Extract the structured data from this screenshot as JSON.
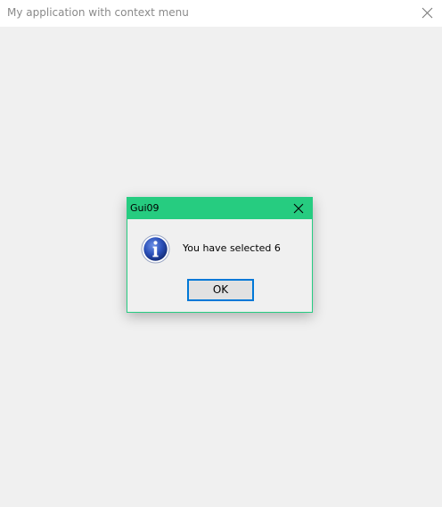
{
  "window": {
    "title": "My application with context menu",
    "close_icon": "close-icon"
  },
  "dialog": {
    "title": "Gui09",
    "close_icon": "close-icon",
    "icon": "info-icon",
    "message": "You have selected 6",
    "ok_label": "OK",
    "accent_color": "#26cc80",
    "button_focus_color": "#0078d7"
  }
}
